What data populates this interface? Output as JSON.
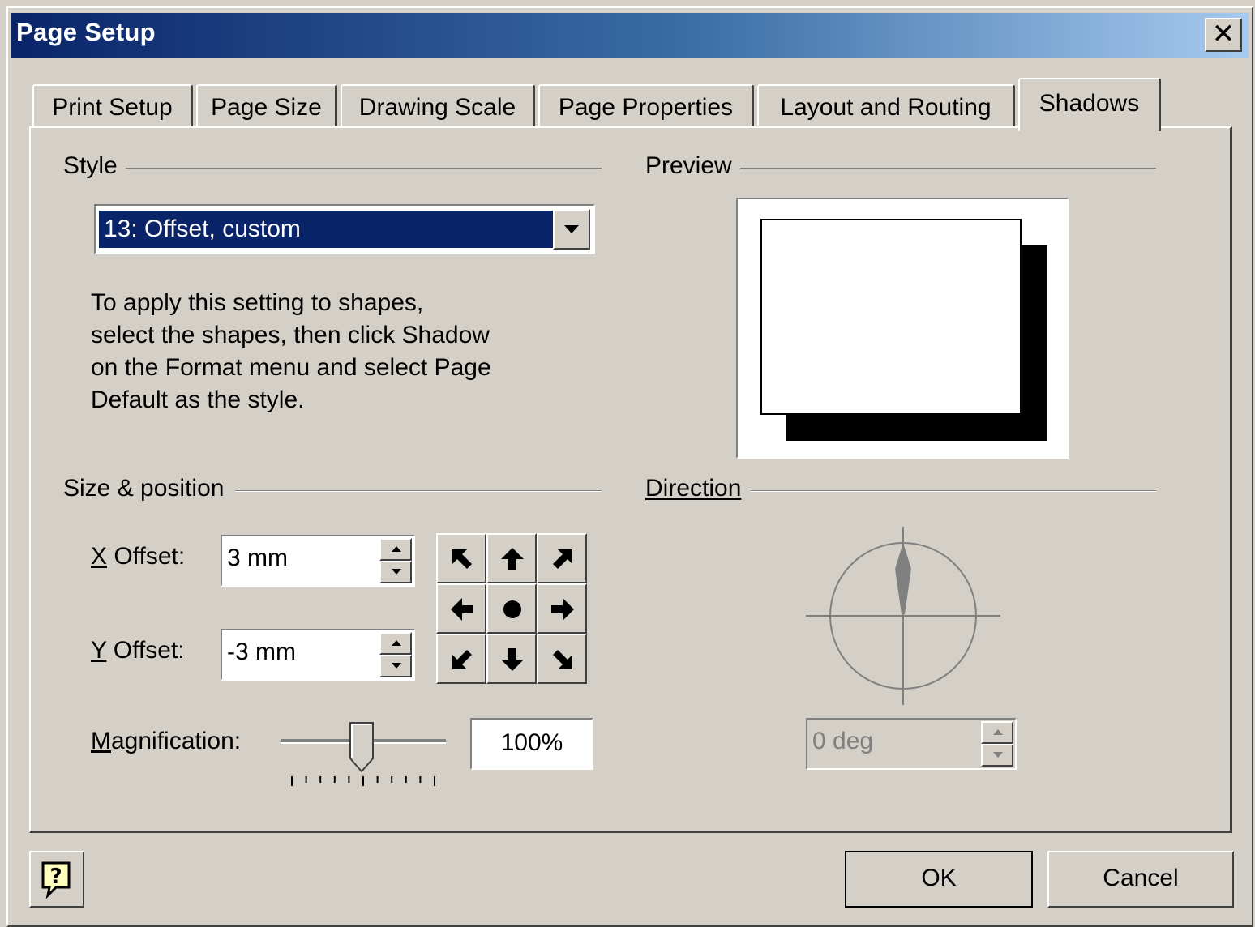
{
  "window": {
    "title": "Page Setup",
    "close_glyph": "✕",
    "close_icon": "close-icon"
  },
  "tabs": [
    {
      "label": "Print Setup",
      "active": false
    },
    {
      "label": "Page Size",
      "active": false
    },
    {
      "label": "Drawing Scale",
      "active": false
    },
    {
      "label": "Page Properties",
      "active": false
    },
    {
      "label": "Layout and Routing",
      "active": false
    },
    {
      "label": "Shadows",
      "active": true
    }
  ],
  "style_group": {
    "label": "Style",
    "selected": "13: Offset, custom",
    "help_text": [
      "To apply this setting to shapes,",
      "select the shapes, then click Shadow",
      "on the Format menu and select Page",
      "Default as the style."
    ]
  },
  "preview_group": {
    "label": "Preview"
  },
  "size_position": {
    "label": "Size & position",
    "x_offset_label": "X Offset:",
    "x_offset_value": "3 mm",
    "y_offset_label": "Y Offset:",
    "y_offset_value": "-3 mm",
    "magnification_label": "Magnification:",
    "magnification_value": "100%",
    "magnification_slider_fraction": 0.5,
    "direction_buttons": [
      "up-left",
      "up",
      "up-right",
      "left",
      "center",
      "right",
      "down-left",
      "down",
      "down-right"
    ]
  },
  "direction_group": {
    "label": "Direction",
    "angle_value": "0 deg",
    "angle_enabled": false
  },
  "buttons": {
    "ok": "OK",
    "cancel": "Cancel",
    "help_glyph": "?"
  },
  "colors": {
    "face": "#d4d0c8",
    "title_start": "#0a246a",
    "title_end": "#a6caf0",
    "selection": "#0a246a"
  }
}
